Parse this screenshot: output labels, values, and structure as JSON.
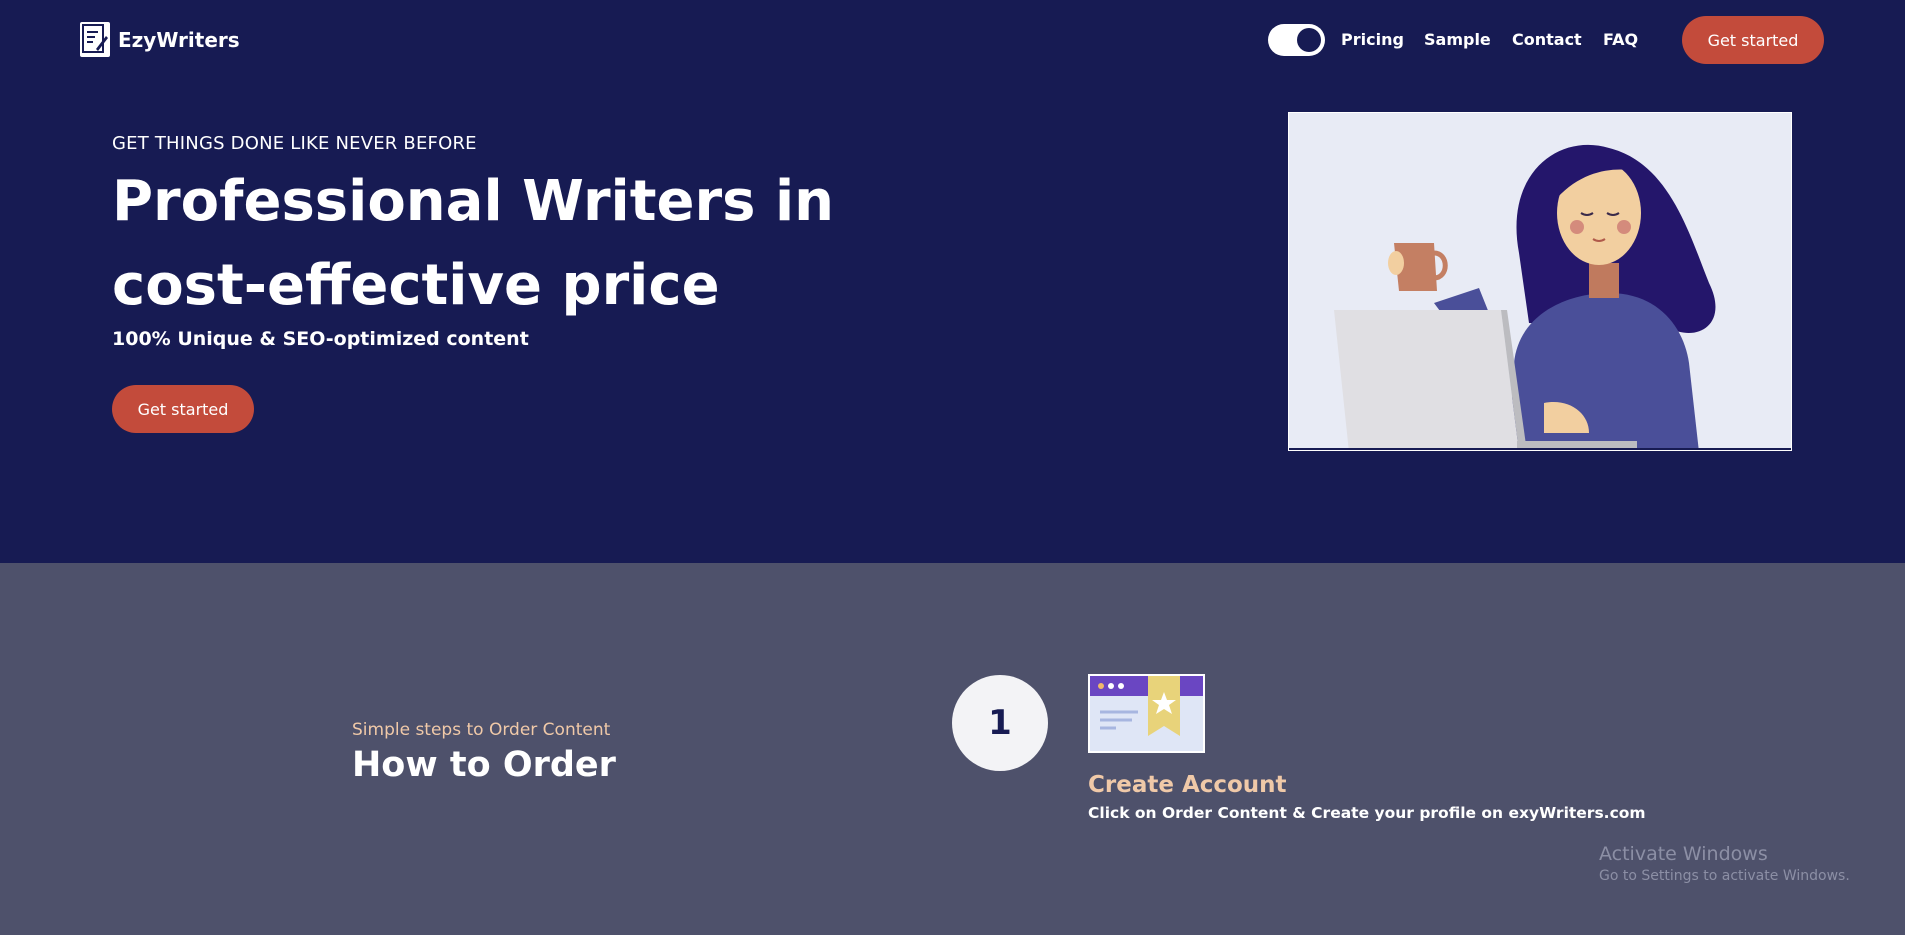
{
  "brand": {
    "name": "EzyWriters"
  },
  "nav": {
    "toggle_state": "on",
    "links": [
      "Pricing",
      "Sample",
      "Contact",
      "FAQ"
    ],
    "cta_label": "Get started"
  },
  "hero": {
    "kicker": "GET THINGS DONE LIKE NEVER BEFORE",
    "title_line1": "Professional Writers in",
    "title_line2": "cost-effective price",
    "subtitle": "100% Unique & SEO-optimized content",
    "cta_label": "Get started"
  },
  "how_to_order": {
    "caption": "Simple steps to Order Content",
    "title": "How to Order",
    "step": {
      "number": "1",
      "title": "Create Account",
      "description": "Click on Order Content & Create your profile on exyWriters.com"
    }
  },
  "windows_watermark": {
    "title": "Activate Windows",
    "subtitle": "Go to Settings to activate Windows."
  },
  "colors": {
    "hero_bg": "#171b53",
    "lower_bg": "#4e516b",
    "accent_button": "#c34b3b",
    "caption_peach": "#f0c9a8"
  }
}
